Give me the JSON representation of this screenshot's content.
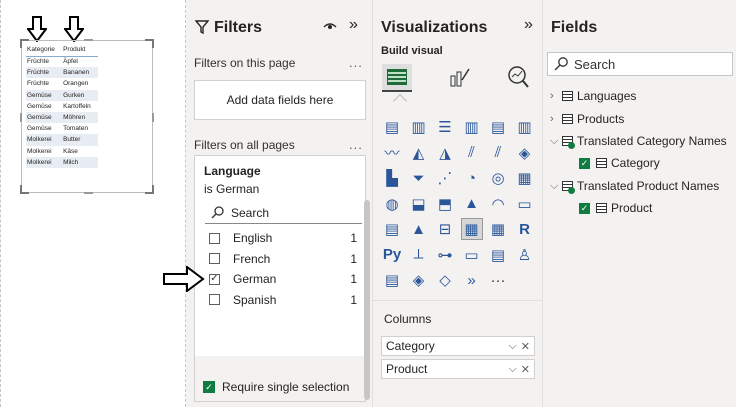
{
  "table_visual": {
    "headers": [
      "Kategorie",
      "Produkt"
    ],
    "rows": [
      [
        "Früchte",
        "Äpfel"
      ],
      [
        "Früchte",
        "Bananen"
      ],
      [
        "Früchte",
        "Orangen"
      ],
      [
        "Gemüse",
        "Gurken"
      ],
      [
        "Gemüse",
        "Kartoffeln"
      ],
      [
        "Gemüse",
        "Möhren"
      ],
      [
        "Gemüse",
        "Tomaten"
      ],
      [
        "Molkerei",
        "Butter"
      ],
      [
        "Molkerei",
        "Käse"
      ],
      [
        "Molkerei",
        "Milch"
      ]
    ]
  },
  "filters": {
    "title": "Filters",
    "on_this_page": "Filters on this page",
    "add_fields": "Add data fields here",
    "on_all_pages": "Filters on all pages",
    "more": "...",
    "card": {
      "field": "Language",
      "summary": "is German",
      "search_placeholder": "Search",
      "options": [
        {
          "label": "English",
          "count": "1",
          "checked": false
        },
        {
          "label": "French",
          "count": "1",
          "checked": false
        },
        {
          "label": "German",
          "count": "1",
          "checked": true
        },
        {
          "label": "Spanish",
          "count": "1",
          "checked": false
        }
      ],
      "require_single": "Require single selection"
    }
  },
  "visualizations": {
    "title": "Visualizations",
    "build_visual": "Build visual",
    "columns_label": "Columns",
    "wells": [
      "Category",
      "Product"
    ],
    "more_visuals": "···"
  },
  "fields": {
    "title": "Fields",
    "search_placeholder": "Search",
    "tables": [
      {
        "label": "Languages",
        "expanded": false
      },
      {
        "label": "Products",
        "expanded": false
      },
      {
        "label": "Translated Category Names",
        "expanded": true,
        "children": [
          "Category"
        ]
      },
      {
        "label": "Translated Product Names",
        "expanded": true,
        "children": [
          "Product"
        ]
      }
    ]
  },
  "colors": {
    "accent": "#2b579a",
    "check_green": "#107c41",
    "pane_bg": "#f3f2f1"
  }
}
